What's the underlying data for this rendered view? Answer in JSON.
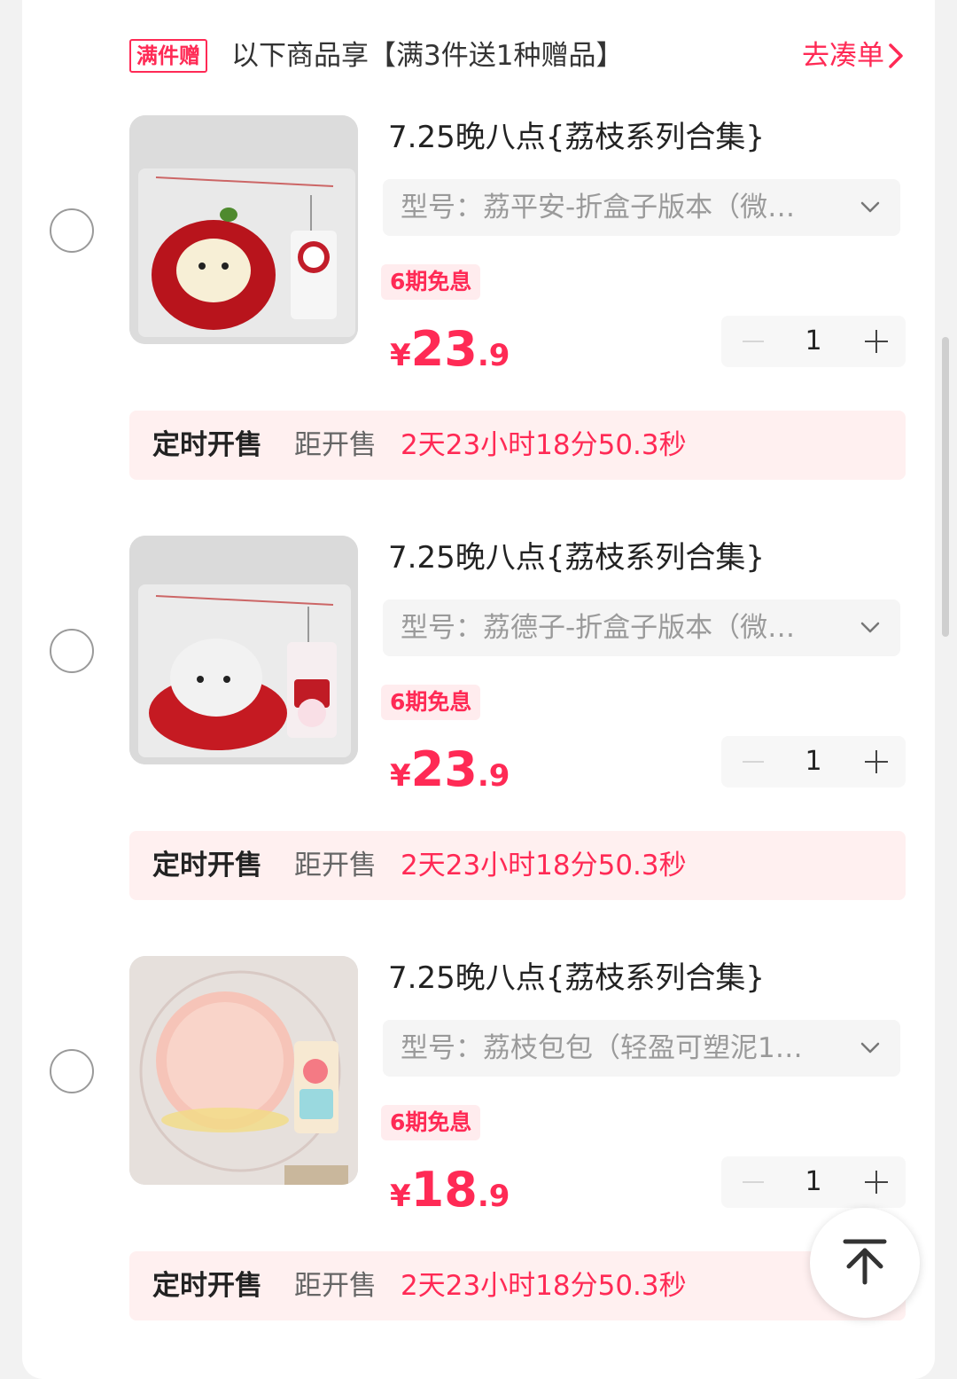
{
  "promo": {
    "tag": "满件赠",
    "text": "以下商品享【满3件送1种赠品】",
    "link": "去凑单"
  },
  "items": [
    {
      "title": "7.25晚八点{荔枝系列合集}",
      "spec": "型号：荔平安-折盒子版本（微…",
      "badge": "6期免息",
      "price_currency": "¥",
      "price_int": "23",
      "price_dec": ".9",
      "qty": "1",
      "timer_label": "定时开售",
      "timer_prefix": "距开售",
      "timer_value": "2天23小时18分50.3秒"
    },
    {
      "title": "7.25晚八点{荔枝系列合集}",
      "spec": "型号：荔德子-折盒子版本（微…",
      "badge": "6期免息",
      "price_currency": "¥",
      "price_int": "23",
      "price_dec": ".9",
      "qty": "1",
      "timer_label": "定时开售",
      "timer_prefix": "距开售",
      "timer_value": "2天23小时18分50.3秒"
    },
    {
      "title": "7.25晚八点{荔枝系列合集}",
      "spec": "型号：荔枝包包（轻盈可塑泥1…",
      "badge": "6期免息",
      "price_currency": "¥",
      "price_int": "18",
      "price_dec": ".9",
      "qty": "1",
      "timer_label": "定时开售",
      "timer_prefix": "距开售",
      "timer_value": "2天23小时18分50.3秒"
    }
  ],
  "colors": {
    "accent": "#ff2a55",
    "timer_bg": "#fff0f0",
    "badge_bg": "#ffecee"
  },
  "icons": {
    "promo_link": "chevron-right-icon",
    "spec": "chevron-down-icon",
    "back_to_top": "arrow-up-to-top-icon"
  }
}
